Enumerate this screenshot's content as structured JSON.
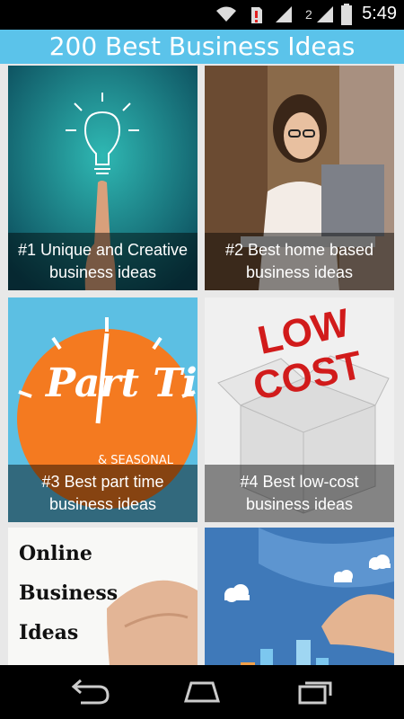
{
  "status_bar": {
    "time": "5:49",
    "network_badge": "2",
    "icons": [
      "wifi-icon",
      "sim-alert-icon",
      "signal-icon",
      "battery-icon"
    ]
  },
  "app_bar": {
    "title": "200 Best Business Ideas",
    "color": "#5bc3ea"
  },
  "cards": [
    {
      "label": "#1 Unique and Creative business ideas",
      "image": "lightbulb-finger-image"
    },
    {
      "label": "#2 Best home based business ideas",
      "image": "woman-laptop-image"
    },
    {
      "label": "#3 Best part time business ideas",
      "image": "part-time-clock-image",
      "image_text": "Part Time",
      "image_subtext": "& SEASONAL"
    },
    {
      "label": "#4 Best low-cost business ideas",
      "image": "low-cost-box-image",
      "image_text": "LOW COST"
    },
    {
      "label": "",
      "image": "online-business-image",
      "image_text": "Online Business Ideas"
    },
    {
      "label": "",
      "image": "city-growth-image"
    }
  ],
  "nav_bar": {
    "icons": [
      "back-icon",
      "home-icon",
      "recents-icon"
    ]
  }
}
